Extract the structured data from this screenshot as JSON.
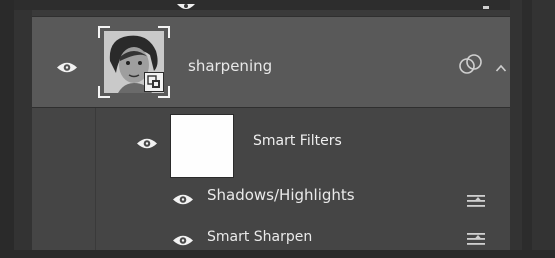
{
  "layer": {
    "name": "sharpening"
  },
  "smart_filters": {
    "label": "Smart Filters"
  },
  "filters": [
    {
      "label": "Shadows/Highlights"
    },
    {
      "label": "Smart Sharpen"
    }
  ],
  "icons": {
    "visibility": "eye-icon",
    "smart_object_badge": "smart-object-badge-icon",
    "link": "linked-circles-icon",
    "collapse": "chevron-up-icon",
    "blending_options": "filter-blending-options-icon"
  },
  "colors": {
    "panel_bg": "#484848",
    "selected_row": "#595959",
    "text": "#e6e6e6"
  }
}
